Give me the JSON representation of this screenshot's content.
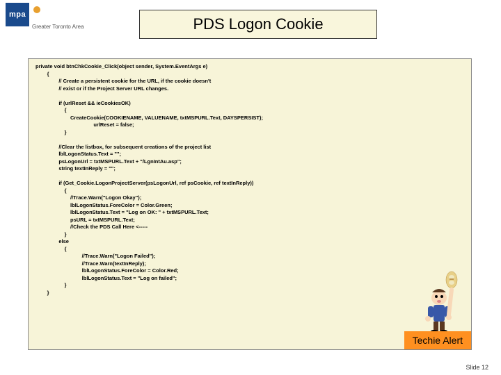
{
  "logo": {
    "abbrev": "mpa",
    "org": "Greater Toronto Area"
  },
  "title": "PDS Logon Cookie",
  "code": {
    "l1": "private void btnChkCookie_Click(object sender, System.EventArgs e)",
    "l2": "        {",
    "l3": "                // Create a persistent cookie for the URL, if the cookie doesn't",
    "l4": "                // exist or if the Project Server URL changes.",
    "l5": " ",
    "l6": "                if (urlReset && ieCookiesOK)",
    "l7": "                    {",
    "l8": "                        CreateCookie(COOKIENAME, VALUENAME, txtMSPURL.Text, DAYSPERSIST);",
    "l9": "                                        urlReset = false;",
    "l10": "                    }",
    "l11": " ",
    "l12": "                //Clear the listbox, for subsequent creations of the project list",
    "l13": "                lblLogonStatus.Text = \"\";",
    "l14": "                psLogonUrl = txtMSPURL.Text + \"/LgnIntAu.asp\";",
    "l15": "                string textInReply = \"\";",
    "l16": " ",
    "l17": "                if (Get_Cookie.LogonProjectServer(psLogonUrl, ref psCookie, ref textInReply))",
    "l18": "                    {",
    "l19": "                        //Trace.Warn(\"Logon Okay\");",
    "l20": "                        lblLogonStatus.ForeColor = Color.Green;",
    "l21": "                        lblLogonStatus.Text = \"Log on OK: \" + txtMSPURL.Text;",
    "l22": "                        psURL = txtMSPURL.Text;",
    "l23": "                        //Check the PDS Call Here <-----",
    "l24": "                    }",
    "l25": "                else",
    "l26": "                    {",
    "l27": "                                //Trace.Warn(\"Logon Failed\");",
    "l28": "                                //Trace.Warn(textInReply);",
    "l29": "                                lblLogonStatus.ForeColor = Color.Red;",
    "l30": "                                lblLogonStatus.Text = \"Log on failed\";",
    "l31": "                    }",
    "l32": "        }"
  },
  "alert": "Techie Alert",
  "footer": {
    "label": "Slide",
    "num": "12"
  }
}
